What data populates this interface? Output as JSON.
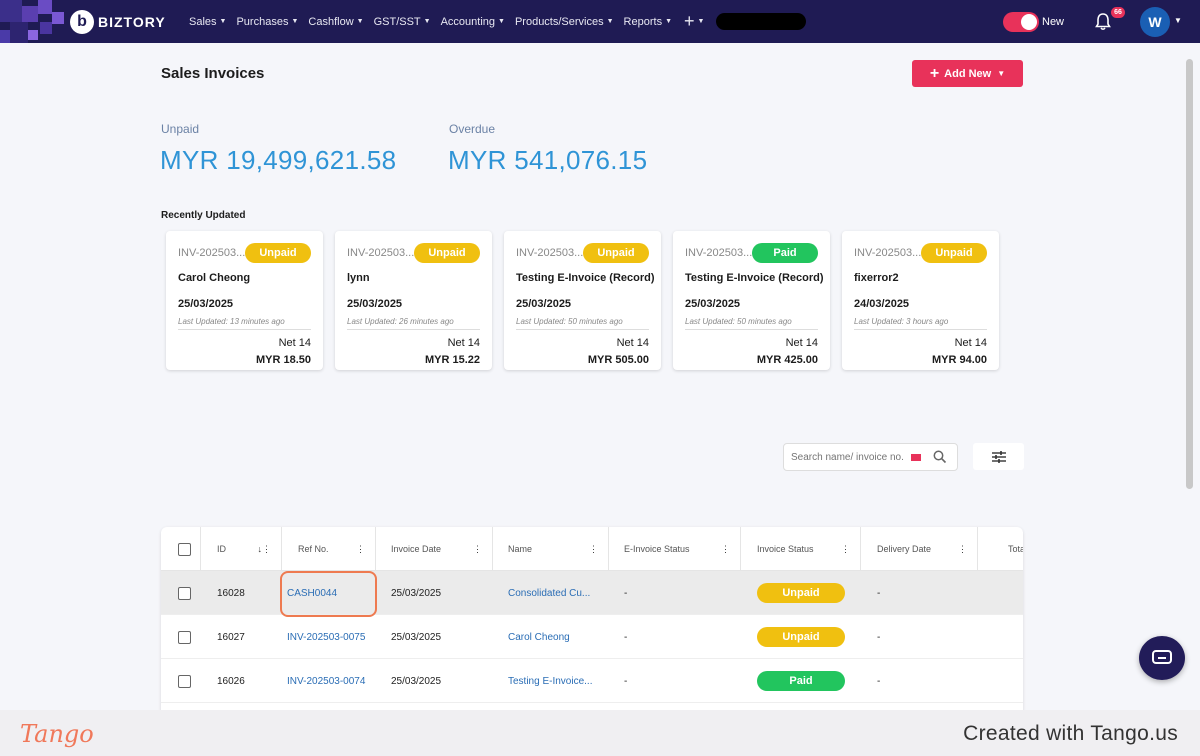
{
  "nav": {
    "brand": "BIZTORY",
    "brand_initial": "b",
    "menu": [
      "Sales",
      "Purchases",
      "Cashflow",
      "GST/SST",
      "Accounting",
      "Products/Services",
      "Reports"
    ],
    "plus": "+",
    "toggle_label": "New",
    "notification_count": "66",
    "avatar_initial": "W"
  },
  "page": {
    "title": "Sales Invoices",
    "add_new_label": "Add New"
  },
  "summary": {
    "unpaid_label": "Unpaid",
    "unpaid_value": "MYR 19,499,621.58",
    "overdue_label": "Overdue",
    "overdue_value": "MYR 541,076.15"
  },
  "recent": {
    "title": "Recently Updated",
    "cards": [
      {
        "inv": "INV-202503...",
        "status": "Unpaid",
        "name": "Carol Cheong",
        "date": "25/03/2025",
        "updated": "Last Updated: 13 minutes ago",
        "term": "Net 14",
        "amount": "MYR 18.50"
      },
      {
        "inv": "INV-202503...",
        "status": "Unpaid",
        "name": "lynn",
        "date": "25/03/2025",
        "updated": "Last Updated: 26 minutes ago",
        "term": "Net 14",
        "amount": "MYR 15.22"
      },
      {
        "inv": "INV-202503...",
        "status": "Unpaid",
        "name": "Testing E-Invoice (Record)",
        "date": "25/03/2025",
        "updated": "Last Updated: 50 minutes ago",
        "term": "Net 14",
        "amount": "MYR 505.00"
      },
      {
        "inv": "INV-202503...",
        "status": "Paid",
        "name": "Testing E-Invoice (Record)",
        "date": "25/03/2025",
        "updated": "Last Updated: 50 minutes ago",
        "term": "Net 14",
        "amount": "MYR 425.00"
      },
      {
        "inv": "INV-202503...",
        "status": "Unpaid",
        "name": "fixerror2",
        "date": "24/03/2025",
        "updated": "Last Updated: 3 hours ago",
        "term": "Net 14",
        "amount": "MYR 94.00"
      }
    ]
  },
  "search": {
    "placeholder": "Search name/ invoice no."
  },
  "table": {
    "columns": [
      "ID",
      "Ref No.",
      "Invoice Date",
      "Name",
      "E-Invoice Status",
      "Invoice Status",
      "Delivery Date",
      "Tota"
    ],
    "rows": [
      {
        "id": "16028",
        "ref": "CASH0044",
        "date": "25/03/2025",
        "name": "Consolidated Cu...",
        "einv": "-",
        "status": "Unpaid",
        "delivery": "-"
      },
      {
        "id": "16027",
        "ref": "INV-202503-0075",
        "date": "25/03/2025",
        "name": "Carol Cheong",
        "einv": "-",
        "status": "Unpaid",
        "delivery": "-"
      },
      {
        "id": "16026",
        "ref": "INV-202503-0074",
        "date": "25/03/2025",
        "name": "Testing E-Invoice...",
        "einv": "-",
        "status": "Paid",
        "delivery": "-"
      }
    ]
  },
  "colors": {
    "nav_bg": "#1f1b54",
    "accent": "#e8325a",
    "unpaid": "#f0c010",
    "paid": "#22c55e",
    "link": "#2a6db5",
    "highlight_ring": "#ee7a50"
  },
  "footer": {
    "logo": "Tango",
    "created": "Created with Tango.us"
  }
}
